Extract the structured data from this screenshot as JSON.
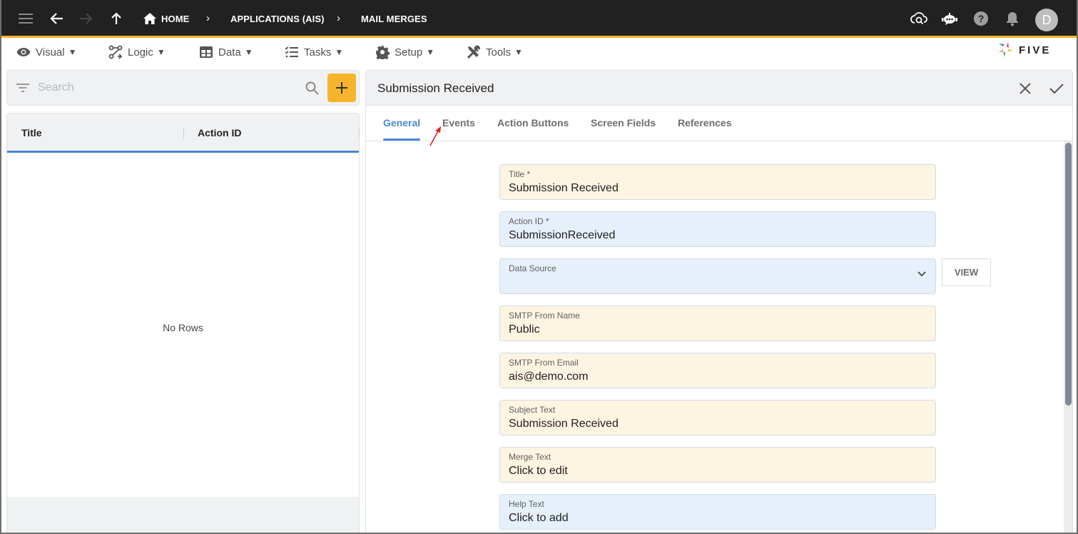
{
  "topbar": {
    "breadcrumbs": [
      "HOME",
      "APPLICATIONS (AIS)",
      "MAIL MERGES"
    ],
    "avatar_initial": "D",
    "icons": [
      "menu-icon",
      "back-arrow-icon",
      "forward-arrow-icon",
      "up-arrow-icon",
      "home-icon",
      "cloud-search-icon",
      "chatbot-icon",
      "help-icon",
      "bell-icon"
    ],
    "accent_color": "#f6b42c"
  },
  "menubar": {
    "items": [
      {
        "label": "Visual",
        "icon": "eye-icon"
      },
      {
        "label": "Logic",
        "icon": "logic-icon"
      },
      {
        "label": "Data",
        "icon": "table-icon"
      },
      {
        "label": "Tasks",
        "icon": "tasks-icon"
      },
      {
        "label": "Setup",
        "icon": "gear-icon"
      },
      {
        "label": "Tools",
        "icon": "tools-icon"
      }
    ],
    "caret": "▼",
    "logo_text": "FIVE"
  },
  "list_panel": {
    "search_placeholder": "Search",
    "columns": [
      "Title",
      "Action ID"
    ],
    "empty_text": "No Rows"
  },
  "form": {
    "title": "Submission Received",
    "tabs": [
      "General",
      "Events",
      "Action Buttons",
      "Screen Fields",
      "References"
    ],
    "active_tab": "General",
    "fields": [
      {
        "label": "Title *",
        "value": "Submission Received"
      },
      {
        "label": "Action ID *",
        "value": "SubmissionReceived"
      },
      {
        "label": "Data Source",
        "value": ""
      },
      {
        "label": "SMTP From Name",
        "value": "Public"
      },
      {
        "label": "SMTP From Email",
        "value": "ais@demo.com"
      },
      {
        "label": "Subject Text",
        "value": "Submission Received"
      },
      {
        "label": "Merge Text",
        "value": "Click to edit"
      },
      {
        "label": "Help Text",
        "value": "Click to add"
      }
    ],
    "view_button": "VIEW"
  }
}
